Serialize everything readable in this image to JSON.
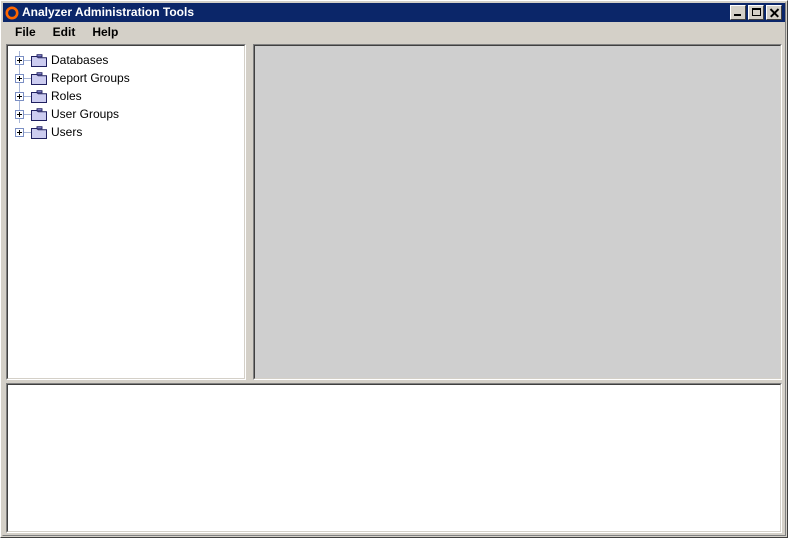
{
  "window": {
    "title": "Analyzer Administration Tools",
    "icon": "orange-ring-icon",
    "titlebar_color": "#0b2669",
    "face_color": "#d4d0c8",
    "controls": [
      {
        "name": "minimize-button",
        "label": "_"
      },
      {
        "name": "maximize-button",
        "label": "□"
      },
      {
        "name": "close-button",
        "label": "✕"
      }
    ]
  },
  "menubar": {
    "items": [
      {
        "label": "File"
      },
      {
        "label": "Edit"
      },
      {
        "label": "Help"
      }
    ]
  },
  "tree": {
    "expander_glyph": "+",
    "folder_icon": "folder-icon",
    "folder_color": "#ccccf0",
    "items": [
      {
        "label": "Databases",
        "expanded": false
      },
      {
        "label": "Report Groups",
        "expanded": false
      },
      {
        "label": "Roles",
        "expanded": false
      },
      {
        "label": "User Groups",
        "expanded": false
      },
      {
        "label": "Users",
        "expanded": false
      }
    ]
  },
  "panels": {
    "detail_panel": {
      "content": "",
      "background": "#cfcfcf"
    },
    "output_panel": {
      "content": "",
      "background": "#ffffff"
    }
  }
}
